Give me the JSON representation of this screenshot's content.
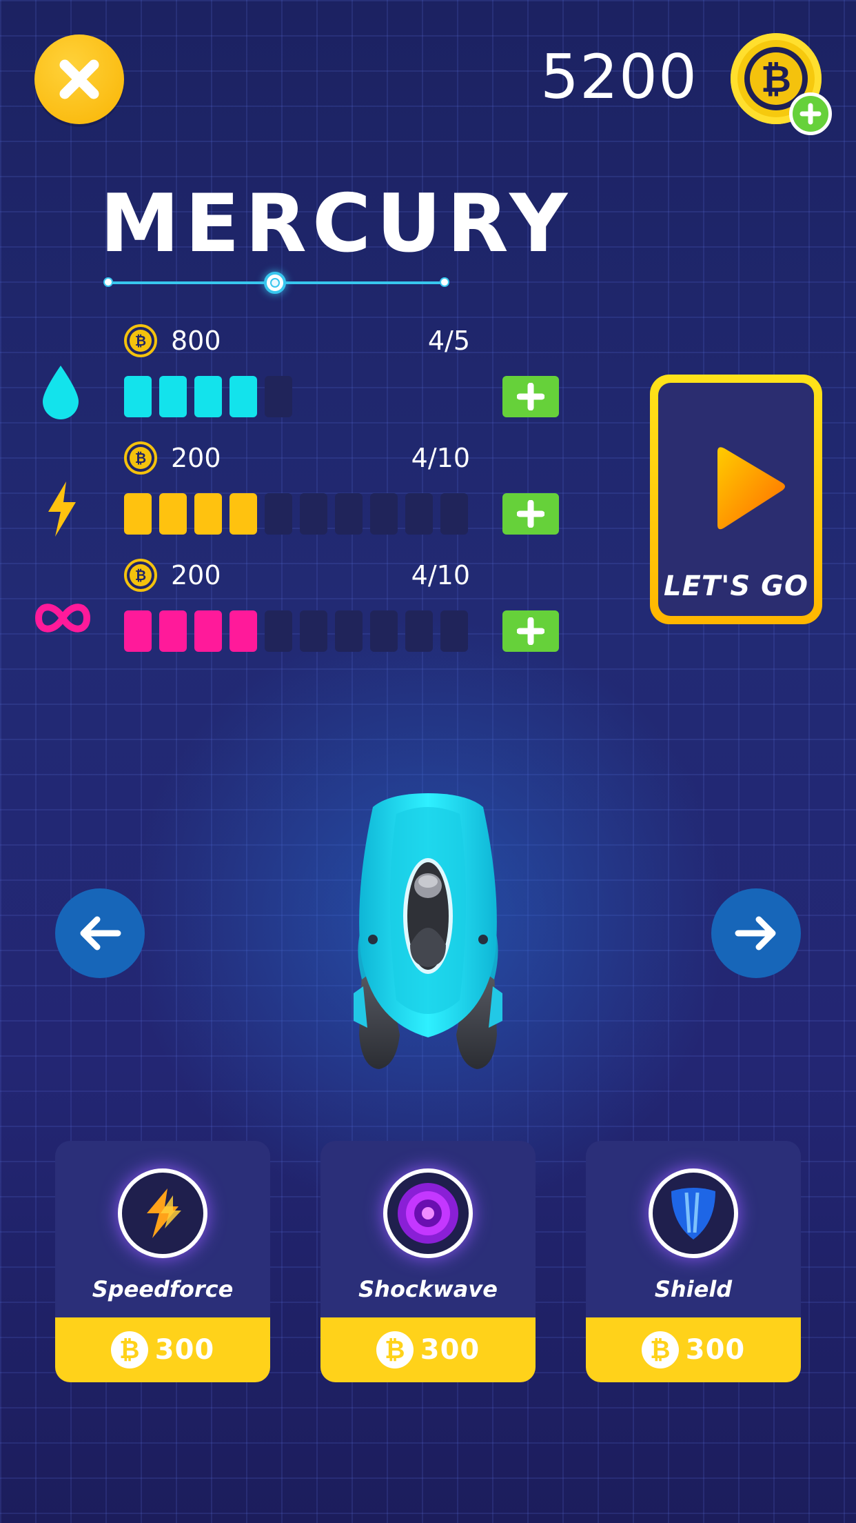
{
  "header": {
    "coins": "5200",
    "coin_symbol": "₿"
  },
  "planet": {
    "name": "MERCURY",
    "selector_position": "2 of 3"
  },
  "stats": [
    {
      "icon": "water-drop-icon",
      "color": "#13e3ec",
      "cost": "800",
      "level_text": "4/5",
      "filled": 4,
      "total": 5
    },
    {
      "icon": "lightning-icon",
      "color": "#ffc20f",
      "cost": "200",
      "level_text": "4/10",
      "filled": 4,
      "total": 10
    },
    {
      "icon": "infinity-icon",
      "color": "#ff1a9a",
      "cost": "200",
      "level_text": "4/10",
      "filled": 4,
      "total": 10
    }
  ],
  "play": {
    "label": "LET'S GO"
  },
  "powerups": [
    {
      "name": "Speedforce",
      "icon": "speedforce-icon",
      "price": "300"
    },
    {
      "name": "Shockwave",
      "icon": "shockwave-icon",
      "price": "300"
    },
    {
      "name": "Shield",
      "icon": "shield-icon",
      "price": "300"
    }
  ],
  "colors": {
    "accent_yellow": "#ffd21a",
    "plus_green": "#66d13a",
    "nav_blue": "#1766b9"
  }
}
